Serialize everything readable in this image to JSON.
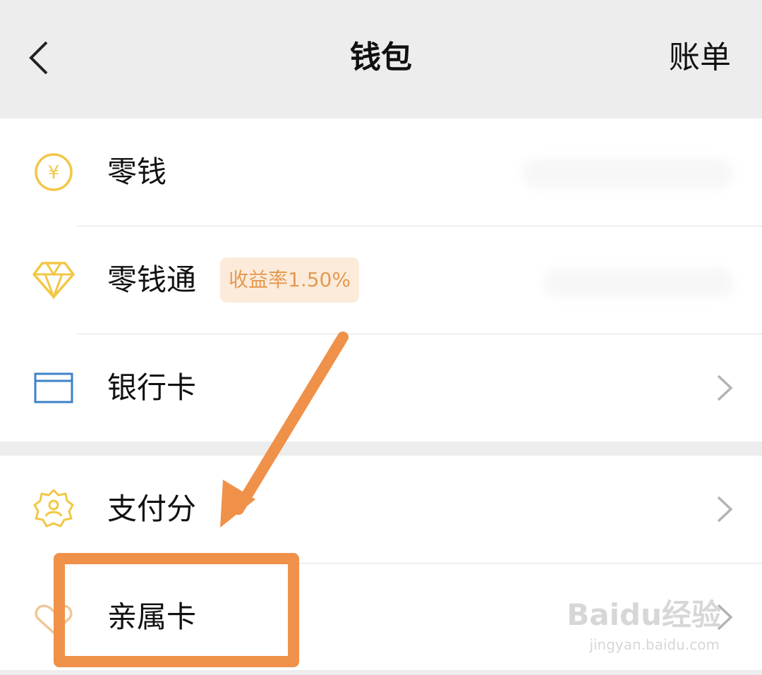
{
  "header": {
    "title": "钱包",
    "bill_label": "账单"
  },
  "items_group1": [
    {
      "label": "零钱"
    },
    {
      "label": "零钱通",
      "badge": "收益率1.50%"
    },
    {
      "label": "银行卡"
    }
  ],
  "items_group2": [
    {
      "label": "支付分"
    },
    {
      "label": "亲属卡"
    }
  ],
  "watermark": {
    "brand": "Baidu经验",
    "url": "jingyan.baidu.com"
  },
  "colors": {
    "icon_gold": "#f2c744",
    "icon_blue": "#3e82c8",
    "badge_bg": "#fcebda",
    "badge_text": "#e39a52",
    "annotation": "#f0914a"
  }
}
